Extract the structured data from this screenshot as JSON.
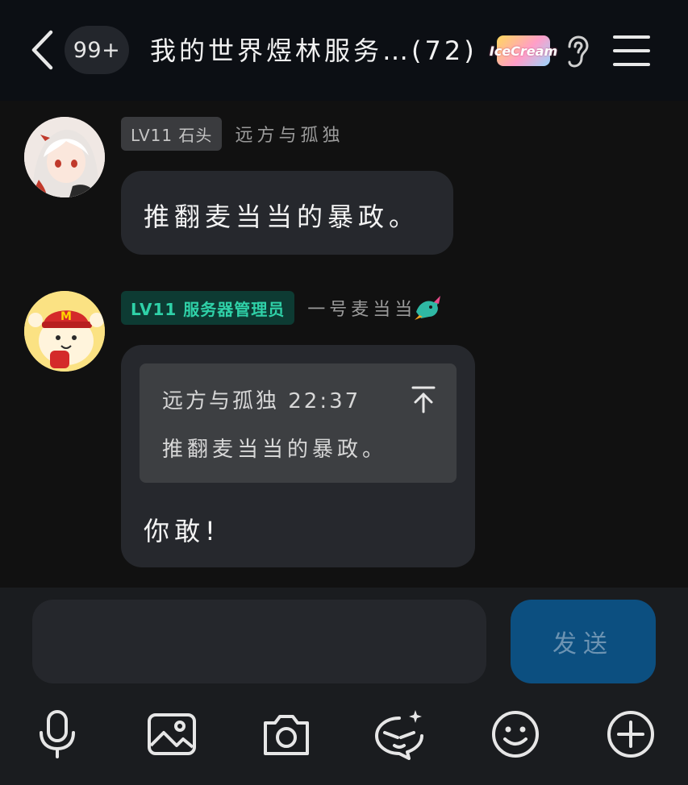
{
  "header": {
    "unread_count": "99+",
    "title": "我的世界煜林服务…(72)",
    "badge_text": "IceCream"
  },
  "messages": [
    {
      "level": "LV11 石头",
      "sender": "远方与孤独",
      "text": "推翻麦当当的暴政。"
    },
    {
      "level": "LV11 服务器管理员",
      "sender": "一号麦当当",
      "quote": {
        "author_time": "远方与孤独 22:37",
        "text": "推翻麦当当的暴政。"
      },
      "text": "你敢!"
    }
  ],
  "composer": {
    "input_value": "",
    "send_label": "发送"
  },
  "toolbar": [
    "microphone-icon",
    "image-icon",
    "camera-icon",
    "sticker-magic-icon",
    "emoji-icon",
    "plus-icon"
  ],
  "colors": {
    "background": "#111111",
    "header": "#0c0f14",
    "bubble": "#26282d",
    "send_button": "#0c4f80",
    "admin_tag": "#2fd1a8"
  }
}
